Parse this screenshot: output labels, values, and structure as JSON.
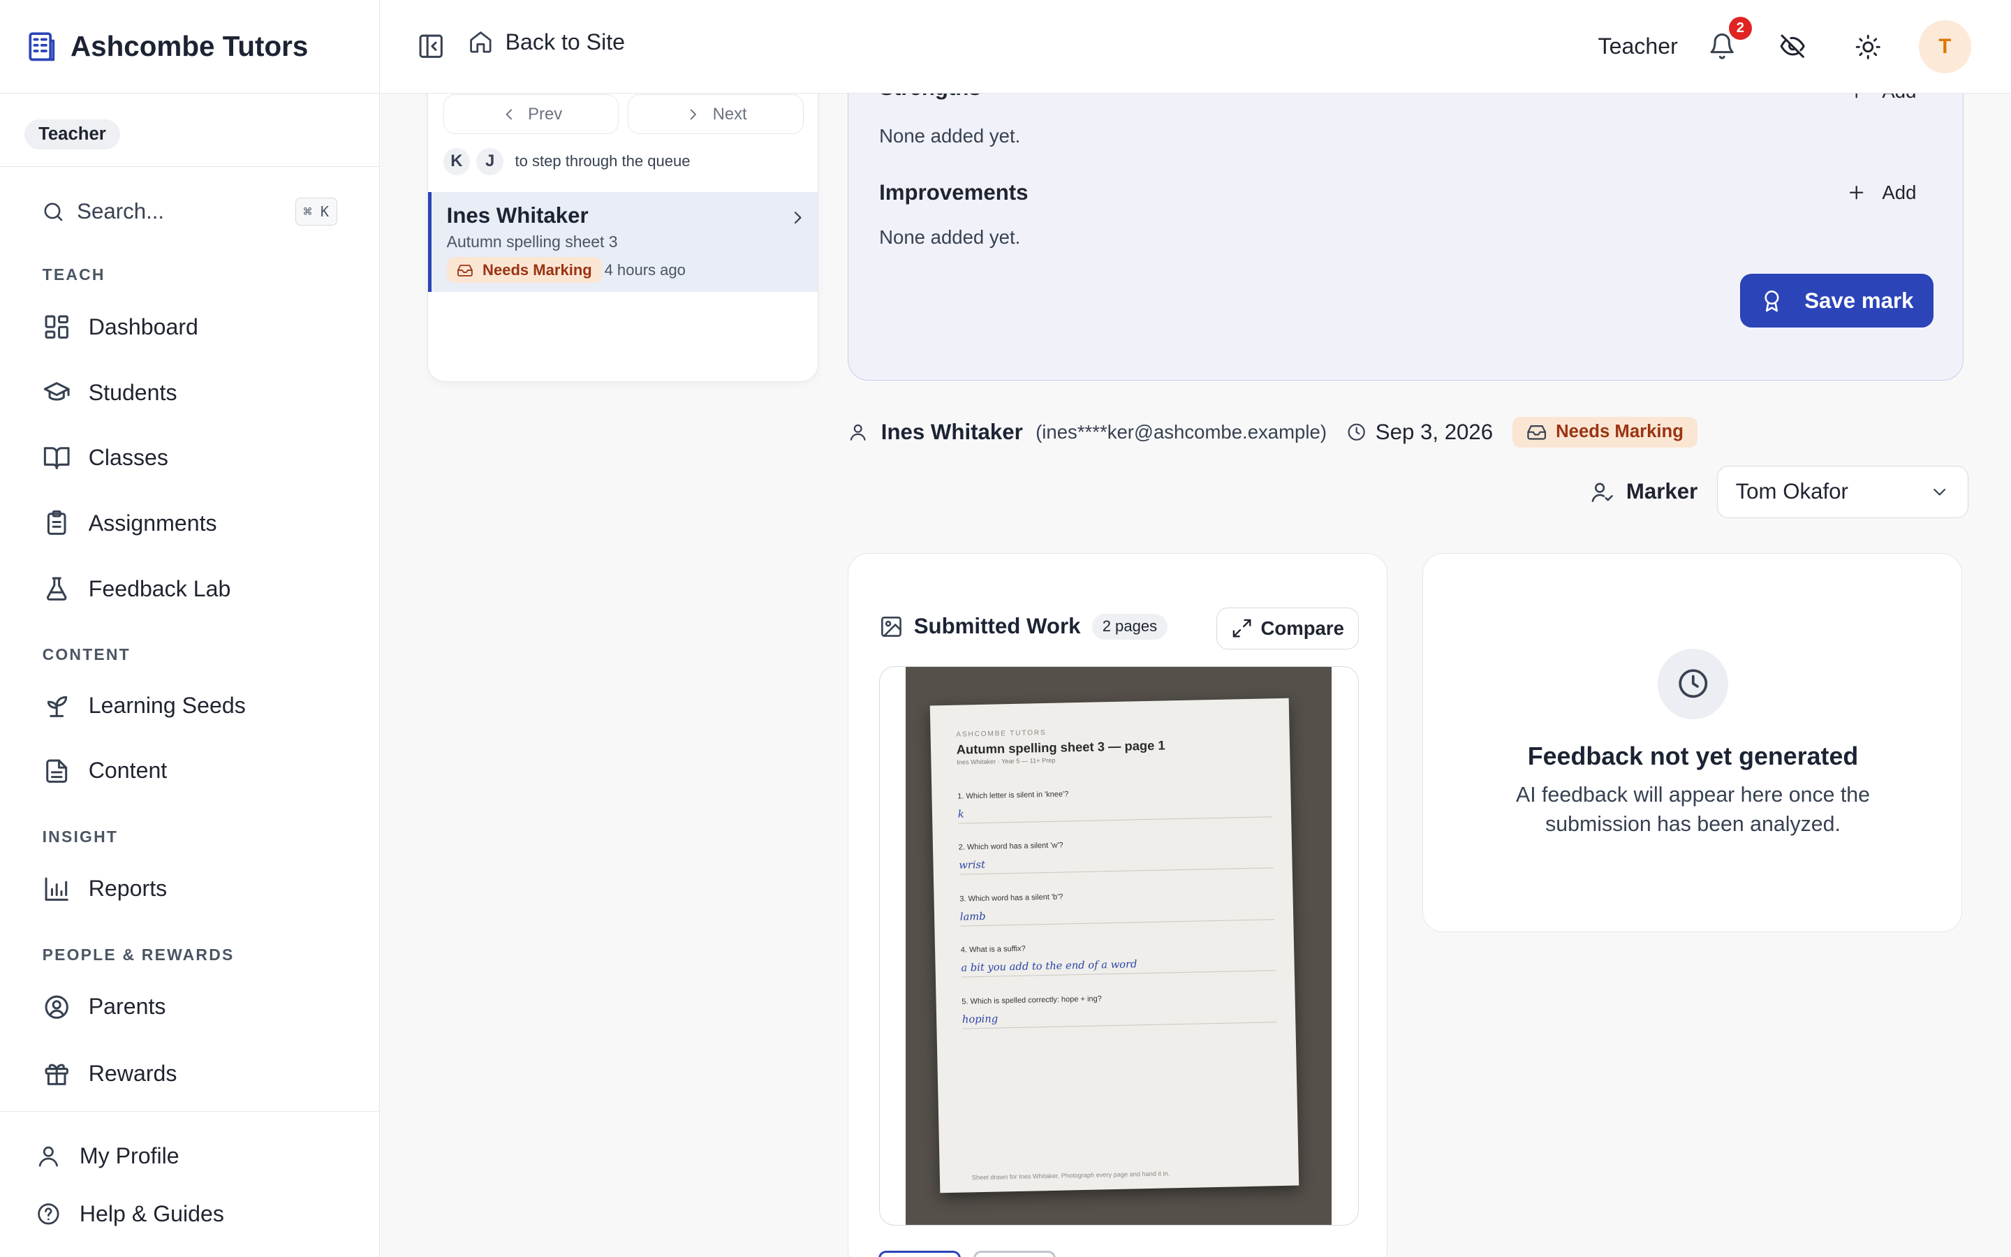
{
  "brand": {
    "name": "Ashcombe Tutors"
  },
  "sidebar": {
    "role_badge": "Teacher",
    "search": {
      "label": "Search...",
      "shortcut": "⌘ K"
    },
    "sections": {
      "teach": "TEACH",
      "content": "CONTENT",
      "insight": "INSIGHT",
      "people": "PEOPLE & REWARDS"
    },
    "items": {
      "dashboard": "Dashboard",
      "students": "Students",
      "classes": "Classes",
      "assignments": "Assignments",
      "feedback_lab": "Feedback Lab",
      "learning_seeds": "Learning Seeds",
      "content": "Content",
      "reports": "Reports",
      "parents": "Parents",
      "rewards": "Rewards"
    },
    "footer": {
      "profile": "My Profile",
      "help": "Help & Guides"
    }
  },
  "topbar": {
    "back_label": "Back to Site",
    "role": "Teacher",
    "notification_count": "2",
    "avatar_initial": "T"
  },
  "queue": {
    "prev": "Prev",
    "next": "Next",
    "key_k": "K",
    "key_j": "J",
    "hint": "to step through the queue",
    "item": {
      "name": "Ines Whitaker",
      "assignment": "Autumn spelling sheet 3",
      "status": "Needs Marking",
      "time": "4 hours ago"
    }
  },
  "feedback": {
    "strengths_heading": "Strengths",
    "strengths_empty": "None added yet.",
    "improvements_heading": "Improvements",
    "improvements_empty": "None added yet.",
    "add_label": "Add",
    "save_label": "Save mark"
  },
  "submission": {
    "student_name": "Ines Whitaker",
    "email": "(ines****ker@ashcombe.example)",
    "date": "Sep 3, 2026",
    "status": "Needs Marking",
    "marker_label": "Marker",
    "marker_value": "Tom Okafor"
  },
  "work": {
    "title": "Submitted Work",
    "pages": "2 pages",
    "compare": "Compare",
    "sheet": {
      "brand": "ASHCOMBE TUTORS",
      "title": "Autumn spelling sheet 3 — page 1",
      "meta": "Ines Whitaker · Year 5 — 11+ Prep",
      "questions": [
        {
          "q": "1. Which letter is silent in 'knee'?",
          "a": "k"
        },
        {
          "q": "2. Which word has a silent 'w'?",
          "a": "wrist"
        },
        {
          "q": "3. Which word has a silent 'b'?",
          "a": "lamb"
        },
        {
          "q": "4. What is a suffix?",
          "a": "a bit you add to the end of a word"
        },
        {
          "q": "5. Which is spelled correctly: hope + ing?",
          "a": "hoping"
        }
      ],
      "footer": "Sheet drawn for Ines Whitaker. Photograph every page and hand it in."
    }
  },
  "ai_feedback": {
    "title": "Feedback not yet generated",
    "description": "AI feedback will appear here once the submission has been analyzed."
  },
  "colors": {
    "accent": "#2b44b7",
    "status_bg": "#fbe6d4",
    "status_text": "#9a3412",
    "badge_red": "#e02424"
  }
}
